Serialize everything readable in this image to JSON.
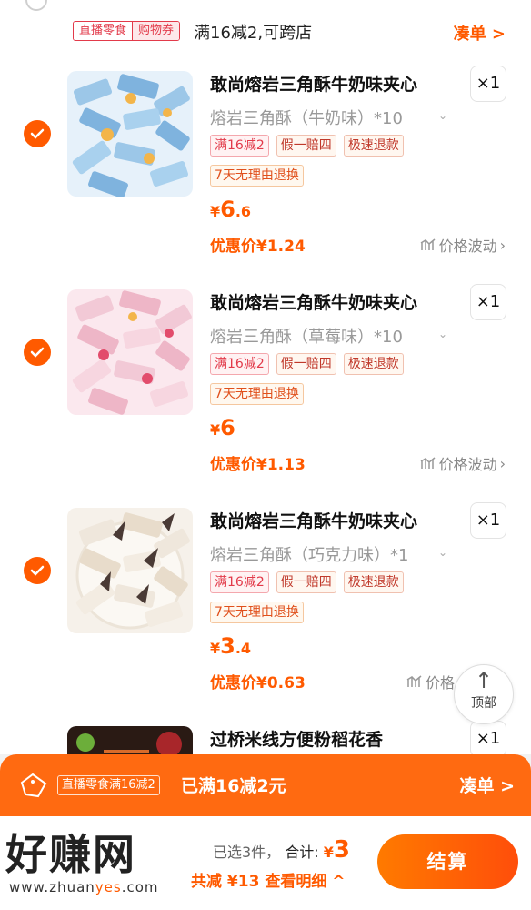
{
  "shop_header": {
    "tag_left": "直播零食",
    "tag_right": "购物券",
    "promo": "满16减2,可跨店",
    "link": "凑单 >"
  },
  "items": [
    {
      "title": "敢尚熔岩三角酥牛奶味夹心",
      "qty": "×1",
      "sku": "熔岩三角酥（牛奶味）*10",
      "tags": [
        "满16减2",
        "假一赔四",
        "极速退款"
      ],
      "tag2": "7天无理由退换",
      "price_currency": "¥",
      "price_int": "6",
      "price_dec": ".6",
      "discount": "优惠价¥1.24",
      "trend": "价格波动",
      "selected": true,
      "colors": {
        "base": "#9cc7e8",
        "wrap": "#cfe6f7",
        "accent": "#f3b54a"
      }
    },
    {
      "title": "敢尚熔岩三角酥牛奶味夹心",
      "qty": "×1",
      "sku": "熔岩三角酥（草莓味）*10",
      "tags": [
        "满16减2",
        "假一赔四",
        "极速退款"
      ],
      "tag2": "7天无理由退换",
      "price_currency": "¥",
      "price_int": "6",
      "price_dec": "",
      "discount": "优惠价¥1.13",
      "trend": "价格波动",
      "selected": true,
      "colors": {
        "base": "#f2c9d6",
        "wrap": "#fbe3ea",
        "accent": "#e24c6c"
      }
    },
    {
      "title": "敢尚熔岩三角酥牛奶味夹心",
      "qty": "×1",
      "sku": "熔岩三角酥（巧克力味）*1",
      "tags": [
        "满16减2",
        "假一赔四",
        "极速退款"
      ],
      "tag2": "7天无理由退换",
      "price_currency": "¥",
      "price_int": "3",
      "price_dec": ".4",
      "discount": "优惠价¥0.63",
      "trend": "价格",
      "selected": true,
      "colors": {
        "base": "#efe7dc",
        "wrap": "#f8f3ec",
        "accent": "#4a3a35"
      }
    },
    {
      "title": "过桥米线方便粉稻花香",
      "qty": "×1"
    }
  ],
  "back_to_top": {
    "label": "顶部"
  },
  "promo_bar": {
    "tag": "直播零食满16减2",
    "text": "已满16减2元",
    "link": "凑单 >"
  },
  "footer": {
    "watermark_brand": "好赚网",
    "watermark_domain_a": "www.zhuan",
    "watermark_domain_b": "yes",
    "watermark_domain_c": ".com",
    "selected": "已选3件，",
    "total_label": "合计:",
    "total_currency": "¥",
    "total_value": "3",
    "saved": "共减 ¥13  查看明细 ^",
    "checkout": "结算"
  },
  "colors": {
    "accent": "#ff5a00",
    "promo_red": "#e23a4a"
  }
}
